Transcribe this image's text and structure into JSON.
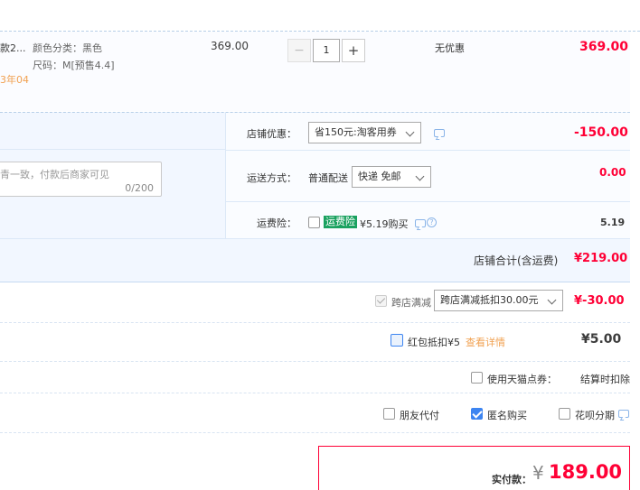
{
  "item": {
    "name_fragment": "款2...",
    "color_label": "颜色分类：黑色",
    "size_label": "尺码：M[预售4.4]",
    "date_fragment": "3年04",
    "unit_price": "369.00",
    "quantity": "1",
    "minus": "−",
    "plus": "+",
    "promo": "无优惠",
    "subtotal": "369.00"
  },
  "store": {
    "coupon_label": "店铺优惠：",
    "coupon_value": "省150元:淘客用券",
    "coupon_amount": "-150.00",
    "message_placeholder": "青一致，付款后商家可见",
    "message_counter": "0/200",
    "shipping_label": "运送方式：",
    "shipping_type": "普通配送",
    "shipping_value": "快递 免邮",
    "shipping_amount": "0.00",
    "insurance_label": "运费险：",
    "insurance_badge": "运费险",
    "insurance_text": "¥5.19购买",
    "insurance_amount": "5.19",
    "total_label": "店铺合计(含运费)",
    "total_value": "¥219.00"
  },
  "discounts": {
    "cross_store_label": "跨店满减",
    "cross_store_value": "跨店满减抵扣30.00元",
    "cross_store_amount": "¥-30.00",
    "red_packet_label": "红包抵扣¥5",
    "red_packet_link": "查看详情",
    "red_packet_amount": "¥5.00",
    "tmall_points_label": "使用天猫点券：",
    "tmall_points_note": "结算时扣除"
  },
  "options": {
    "friend_pay": "朋友代付",
    "anonymous": "匿名购买",
    "huabei": "花呗分期"
  },
  "payment": {
    "label": "实付款：",
    "currency": "¥",
    "amount": "189.00"
  },
  "colors": {
    "price_red": "#ff0036",
    "panel_blue": "#f2f7ff",
    "border_blue": "#c5d9f2",
    "check_blue": "#3d85f1",
    "badge_green": "#19a15f",
    "link_orange": "#f1a151"
  },
  "icons": [
    "chat-icon",
    "help-icon",
    "chevron-down-icon",
    "checkbox-icon"
  ]
}
